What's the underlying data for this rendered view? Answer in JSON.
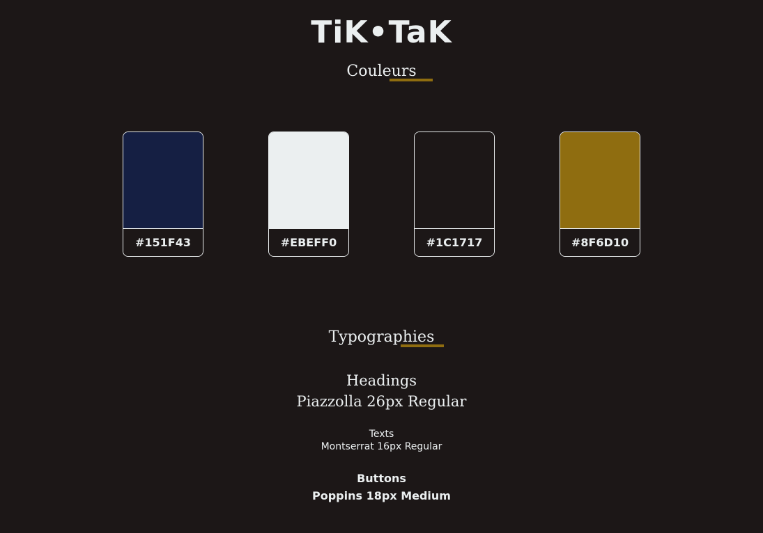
{
  "brand": {
    "logo_text": "TiK•TaK"
  },
  "colors_section": {
    "title": "Couleurs",
    "accent": "#8F6D10",
    "swatches": [
      {
        "hex": "#151F43",
        "label": "#151F43"
      },
      {
        "hex": "#EBEFF0",
        "label": "#EBEFF0"
      },
      {
        "hex": "#1C1717",
        "label": "#1C1717"
      },
      {
        "hex": "#8F6D10",
        "label": "#8F6D10"
      }
    ]
  },
  "typography_section": {
    "title": "Typographies",
    "headings": {
      "label": "Headings",
      "spec": "Piazzolla 26px Regular"
    },
    "texts": {
      "label": "Texts",
      "spec": "Montserrat 16px Regular"
    },
    "buttons": {
      "label": "Buttons",
      "spec": "Poppins 18px Medium"
    }
  }
}
